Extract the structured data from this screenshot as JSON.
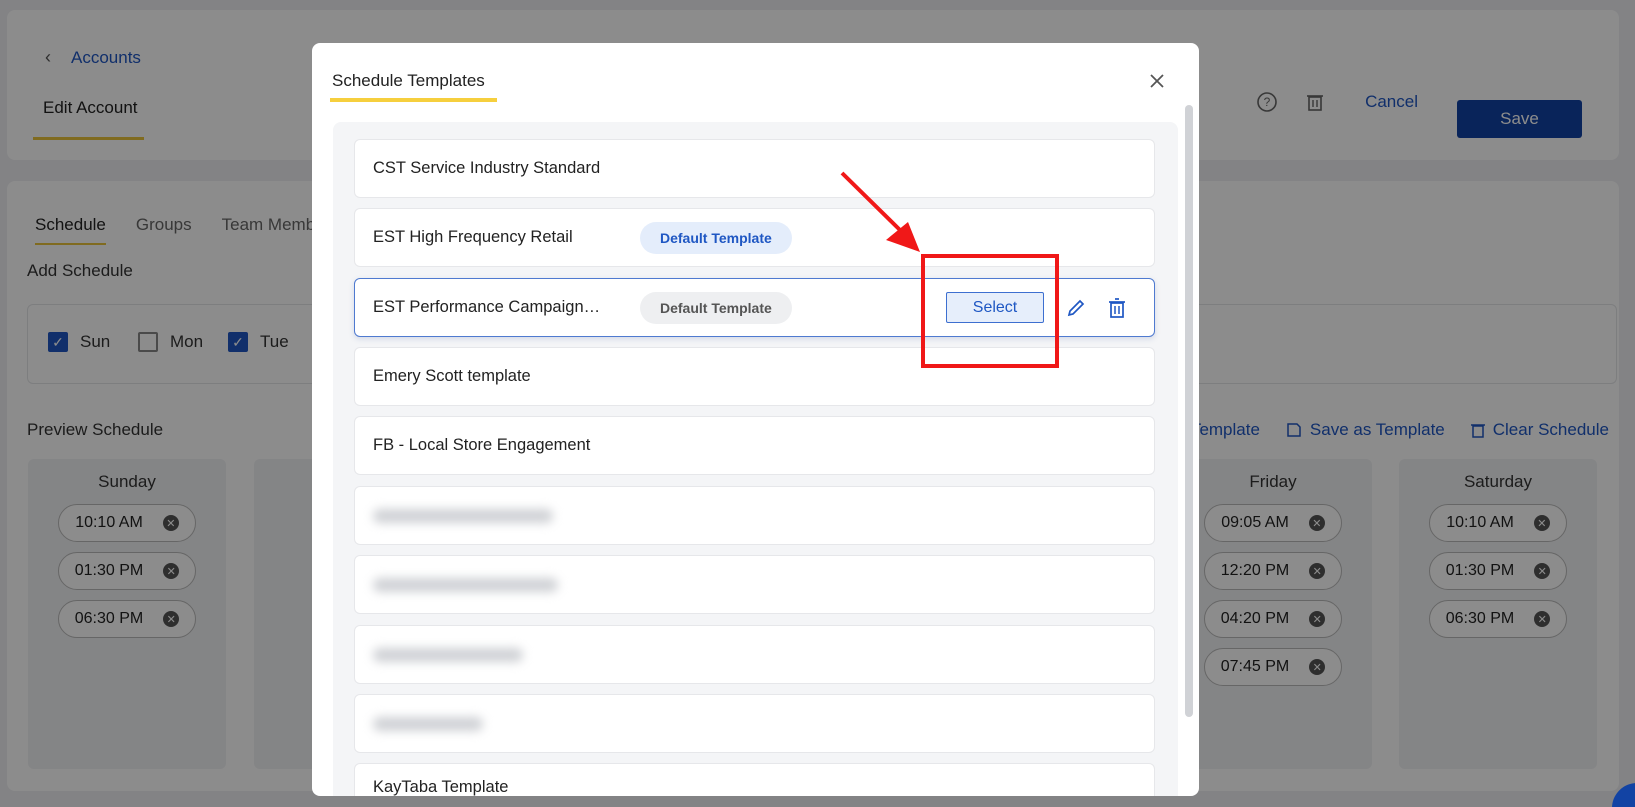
{
  "header": {
    "back_label": "Accounts",
    "edit_tab_label": "Edit Account",
    "cancel_label": "Cancel",
    "save_label": "Save"
  },
  "tabs": [
    "Schedule",
    "Groups",
    "Team Membe"
  ],
  "add_schedule_label": "Add Schedule",
  "days": [
    {
      "label": "Sun",
      "checked": true
    },
    {
      "label": "Mon",
      "checked": false
    },
    {
      "label": "Tue",
      "checked": true
    }
  ],
  "preview": {
    "title": "Preview Schedule",
    "load_template_label": "Template",
    "save_template_label": "Save as Template",
    "clear_label": "Clear Schedule"
  },
  "columns": [
    {
      "day": "Sunday",
      "times": [
        "10:10 AM",
        "01:30 PM",
        "06:30 PM"
      ]
    },
    {
      "day": "Friday",
      "times": [
        "09:05 AM",
        "12:20 PM",
        "04:20 PM",
        "07:45 PM"
      ]
    },
    {
      "day": "Saturday",
      "times": [
        "10:10 AM",
        "01:30 PM",
        "06:30 PM"
      ]
    }
  ],
  "modal": {
    "title": "Schedule Templates",
    "templates": [
      {
        "name": "CST Service Industry Standard",
        "badge": ""
      },
      {
        "name": "EST High Frequency Retail",
        "badge": "Default Template"
      },
      {
        "name": "EST Performance Campaign Template",
        "badge": "Default Template"
      },
      {
        "name": "Emery Scott template",
        "badge": ""
      },
      {
        "name": "FB - Local Store Engagement",
        "badge": ""
      },
      {
        "name": "",
        "badge": ""
      },
      {
        "name": "",
        "badge": ""
      },
      {
        "name": "",
        "badge": ""
      },
      {
        "name": "",
        "badge": ""
      },
      {
        "name": "KayTaba Template",
        "badge": ""
      }
    ],
    "select_label": "Select"
  },
  "colors": {
    "primary": "#1243a4",
    "link": "#1f57c3",
    "accent": "#e9c43b",
    "annotation": "#f01818"
  }
}
